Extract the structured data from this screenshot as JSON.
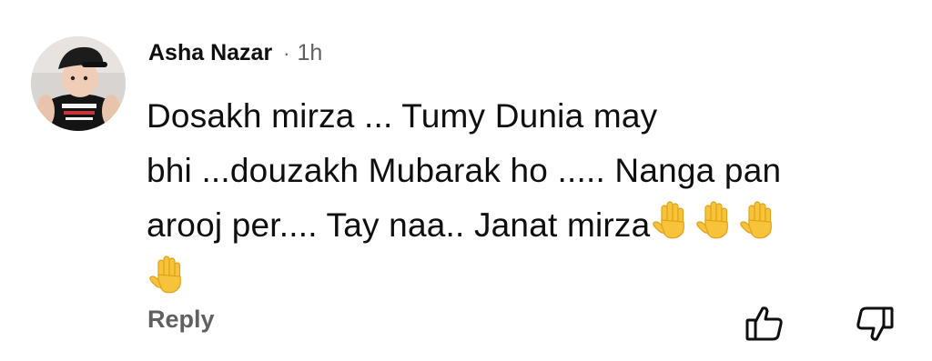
{
  "comment": {
    "author": "Asha Nazar",
    "separator": "·",
    "time": "1h",
    "text_lines": [
      "Dosakh mirza ... Tumy Dunia may",
      "bhi ...douzakh Mubarak ho ..... Nanga pan",
      "arooj per.... Tay naa.. Janat mirza"
    ],
    "emoji_name": "raised-hand",
    "emoji_count_line3": 3,
    "emoji_count_line4": 1
  },
  "actions": {
    "reply_label": "Reply",
    "like_icon": "thumbs-up-icon",
    "dislike_icon": "thumbs-down-icon"
  },
  "colors": {
    "text": "#0f0f0f",
    "secondary": "#606060",
    "emoji": "#f6c33b",
    "emoji_outline": "#e0a21a"
  }
}
